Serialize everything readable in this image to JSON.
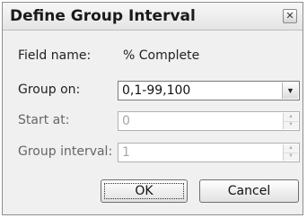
{
  "dialog": {
    "title": "Define Group Interval",
    "close_glyph": "✕",
    "fields": {
      "field_name_label": "Field name:",
      "field_name_value": "% Complete",
      "group_on_label": "Group on:",
      "group_on_value": "0,1-99,100",
      "start_at_label": "Start at:",
      "start_at_value": "0",
      "group_interval_label": "Group interval:",
      "group_interval_value": "1"
    },
    "buttons": {
      "ok": "OK",
      "cancel": "Cancel"
    }
  }
}
